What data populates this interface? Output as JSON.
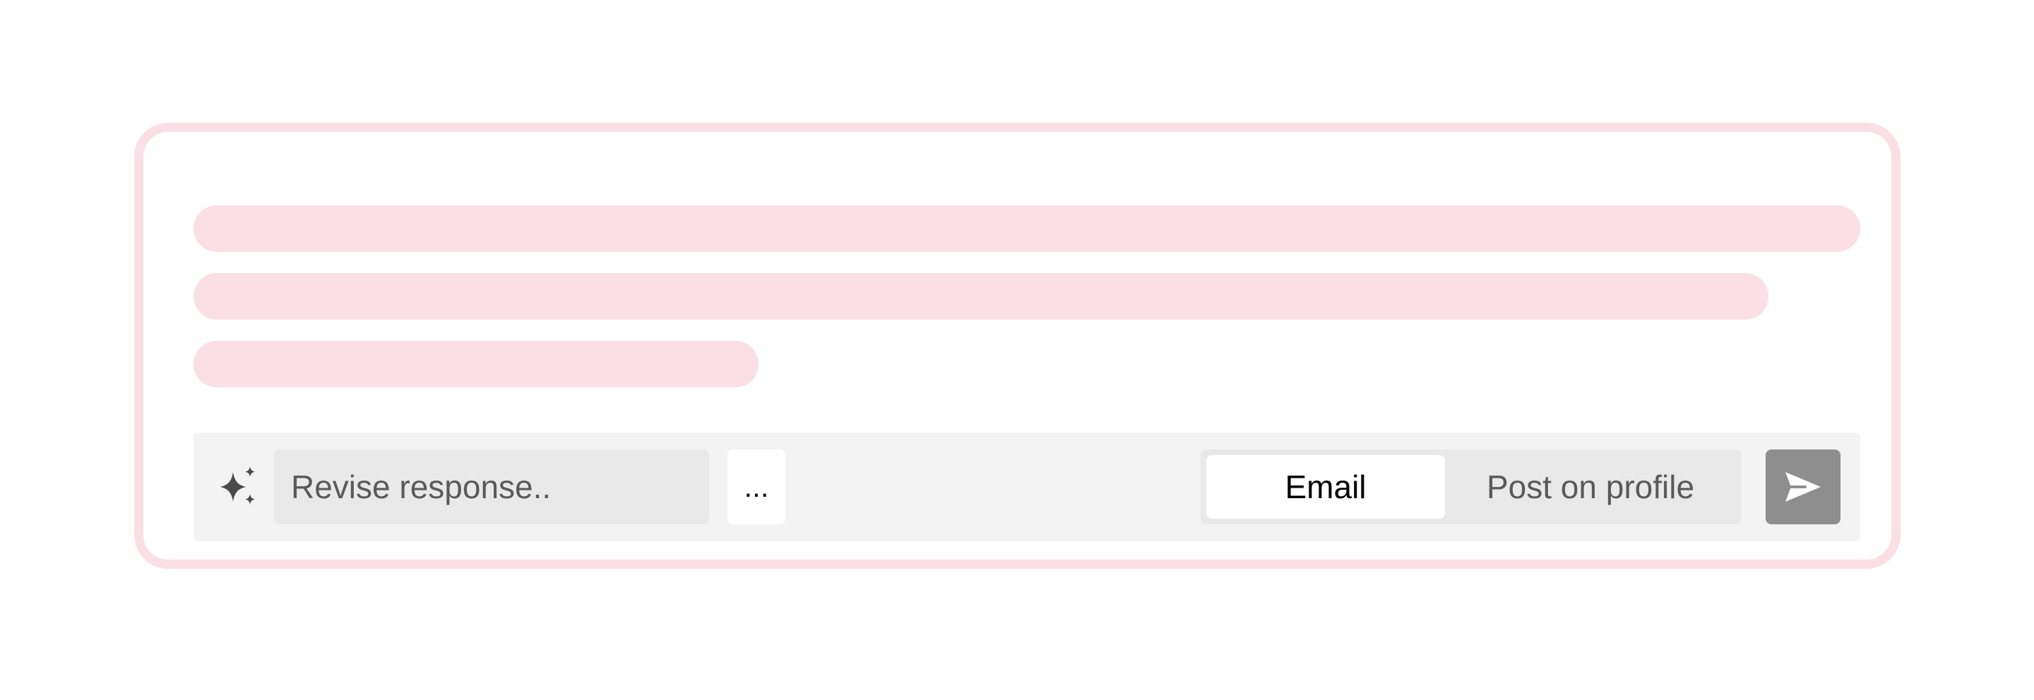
{
  "composer": {
    "revise_placeholder": "Revise response..",
    "more_label": "...",
    "channel_options": [
      "Email",
      "Post on profile"
    ],
    "selected_channel": "Email",
    "icons": {
      "assist": "sparkle-icon",
      "send": "send-icon"
    }
  },
  "colors": {
    "skeleton": "#fbdfe6",
    "toolbar_bg": "#f3f3f3",
    "input_bg": "#e9e9e9",
    "send_bg": "#8e8e8e"
  }
}
